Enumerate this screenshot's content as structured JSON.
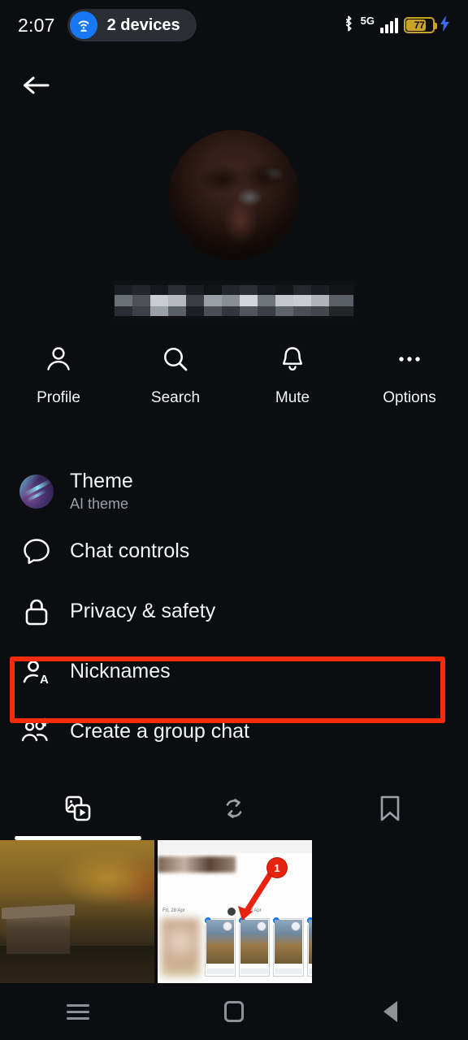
{
  "status_bar": {
    "time": "2:07",
    "hotspot_label": "2 devices",
    "hotspot_icon": "wifi-hotspot-icon",
    "bluetooth_icon": "bluetooth-icon",
    "network_type": "5G",
    "signal_icon": "cellular-signal-icon",
    "battery_percent": "77",
    "charging_icon": "charging-bolt-icon",
    "accent_blue": "#1877f2",
    "battery_color": "#c9a227"
  },
  "header": {
    "back_icon": "back-arrow-icon",
    "avatar_name": "profile-photo",
    "contact_name_redacted": "[redacted]"
  },
  "quick_actions": [
    {
      "label": "Profile",
      "icon": "person-icon"
    },
    {
      "label": "Search",
      "icon": "search-icon"
    },
    {
      "label": "Mute",
      "icon": "bell-icon"
    },
    {
      "label": "Options",
      "icon": "ellipsis-icon"
    }
  ],
  "menu": {
    "highlight_color": "#f42c0a",
    "highlighted_item": "Nicknames",
    "items": [
      {
        "label": "Theme",
        "sublabel": "AI theme",
        "icon": "theme-swatch-icon"
      },
      {
        "label": "Chat controls",
        "sublabel": "",
        "icon": "chat-bubble-icon"
      },
      {
        "label": "Privacy & safety",
        "sublabel": "",
        "icon": "lock-icon"
      },
      {
        "label": "Nicknames",
        "sublabel": "",
        "icon": "person-letter-a-icon"
      },
      {
        "label": "Create a group chat",
        "sublabel": "",
        "icon": "add-people-icon"
      }
    ]
  },
  "tabs": [
    {
      "name": "media",
      "icon": "media-stack-icon",
      "active": true
    },
    {
      "name": "shared",
      "icon": "repeat-arrows-icon",
      "active": false
    },
    {
      "name": "saved",
      "icon": "bookmark-icon",
      "active": false
    }
  ],
  "media_grid": [
    {
      "name": "autumn-cabin-photo",
      "caption": ""
    },
    {
      "name": "annotated-screenshot",
      "annotation_number": "1",
      "meta_text": "Fri, 28 Apr"
    }
  ],
  "nav_bar": [
    {
      "name": "recents-button",
      "icon": "menu-lines-icon"
    },
    {
      "name": "home-button",
      "icon": "square-icon"
    },
    {
      "name": "back-button",
      "icon": "triangle-back-icon"
    }
  ]
}
